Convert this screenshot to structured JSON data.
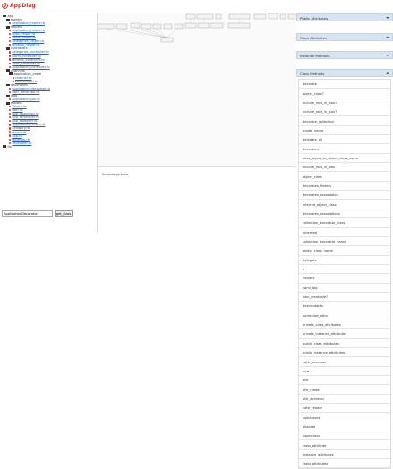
{
  "app": {
    "title": "AppDiag"
  },
  "tree": [
    {
      "kind": "folder",
      "label": "app",
      "depth": 0
    },
    {
      "kind": "folder",
      "label": "mailers",
      "depth": 1
    },
    {
      "kind": "file",
      "label": "application_mailer.rb",
      "depth": 2
    },
    {
      "kind": "folder",
      "label": "helpers",
      "depth": 1
    },
    {
      "kind": "file",
      "label": "application_helper.rb",
      "depth": 2
    },
    {
      "kind": "file",
      "label": "apps_helper.rb",
      "depth": 2
    },
    {
      "kind": "file",
      "label": "users_helper.rb",
      "depth": 2
    },
    {
      "kind": "file",
      "label": "categories_helper.rb",
      "depth": 2
    },
    {
      "kind": "file",
      "label": "reviews_helper.rb",
      "depth": 2
    },
    {
      "kind": "folder",
      "label": "controllers",
      "depth": 1
    },
    {
      "kind": "file",
      "label": "categories_controller.rb",
      "depth": 2
    },
    {
      "kind": "file",
      "label": "users_controller.rb",
      "depth": 2
    },
    {
      "kind": "file",
      "label": "reviews_controller.rb",
      "depth": 2
    },
    {
      "kind": "file",
      "label": "apps_controller.rb",
      "depth": 2
    },
    {
      "kind": "file",
      "label": "application_controller.rb",
      "depth": 2
    },
    {
      "kind": "folder",
      "label": "channels",
      "depth": 1
    },
    {
      "kind": "folder",
      "label": "application_cable",
      "depth": 2
    },
    {
      "kind": "file",
      "label": "channel.rb",
      "depth": 3
    },
    {
      "kind": "file",
      "label": "connection.rb",
      "depth": 3
    },
    {
      "kind": "folder",
      "label": "decorators",
      "depth": 1
    },
    {
      "kind": "file",
      "label": "application_decorator.rb",
      "depth": 2
    },
    {
      "kind": "file",
      "label": "user_decorator.rb",
      "depth": 2
    },
    {
      "kind": "folder",
      "label": "jobs",
      "depth": 1
    },
    {
      "kind": "file",
      "label": "application_job.rb",
      "depth": 2
    },
    {
      "kind": "folder",
      "label": "models",
      "depth": 1
    },
    {
      "kind": "file",
      "label": "device.rb",
      "depth": 2
    },
    {
      "kind": "file",
      "label": "user.rb",
      "depth": 2
    },
    {
      "kind": "file",
      "label": "app_download.rb",
      "depth": 2
    },
    {
      "kind": "file",
      "label": "app_developer.rb",
      "depth": 2
    },
    {
      "kind": "file",
      "label": "app_category.rb",
      "depth": 2
    },
    {
      "kind": "file",
      "label": "application_record.rb",
      "depth": 2
    },
    {
      "kind": "file",
      "label": "category.rb",
      "depth": 2
    },
    {
      "kind": "file",
      "label": "review.rb",
      "depth": 2
    },
    {
      "kind": "file",
      "label": "app.rb",
      "depth": 2
    },
    {
      "kind": "file",
      "label": "reviewer.rb",
      "depth": 2
    },
    {
      "kind": "file",
      "label": "developer.rb",
      "depth": 2
    },
    {
      "kind": "folder",
      "label": "lib",
      "depth": 0
    }
  ],
  "sources": {
    "placeholder_text": "Sources go here"
  },
  "search": {
    "value": "ApplicationDecorator",
    "button_label": "get_class"
  },
  "panels": {
    "public_attributes": "Public Attributes",
    "class_attributes": "Class Attributes",
    "instance_methods": "Instance Methods",
    "class_methods": "Class Methods"
  },
  "class_methods": [
    "decorate",
    "object_class?",
    "include_root_in_json=",
    "include_root_in_json?",
    "decorate_collection",
    "model_name",
    "delegate_all",
    "decorates",
    "alias_object_to_object_class_name",
    "include_root_in_json",
    "object_class",
    "decorates_finders",
    "decorates_association",
    "inferred_object_class",
    "decorates_associations",
    "collection_decorator_class",
    "inherited",
    "collection_decorator_name",
    "object_class_name",
    "delegate",
    "h",
    "helpers",
    "yaml_tag",
    "json_creatable?",
    "descendants",
    "normalize_attrs",
    "private_class_attributes",
    "private_instance_attributes",
    "public_class_attributes",
    "public_instance_attributes",
    "cattr_accessor",
    "new",
    "attr",
    "attr_reader",
    "attr_accessor",
    "cattr_reader",
    "subclasses",
    "allocate",
    "superclass",
    "class_attribute",
    "instance_attributes",
    "class_attributes"
  ],
  "colors": {
    "accent": "#c0392b",
    "panel_header": "#d6e4f3",
    "link": "#2a5db0"
  }
}
